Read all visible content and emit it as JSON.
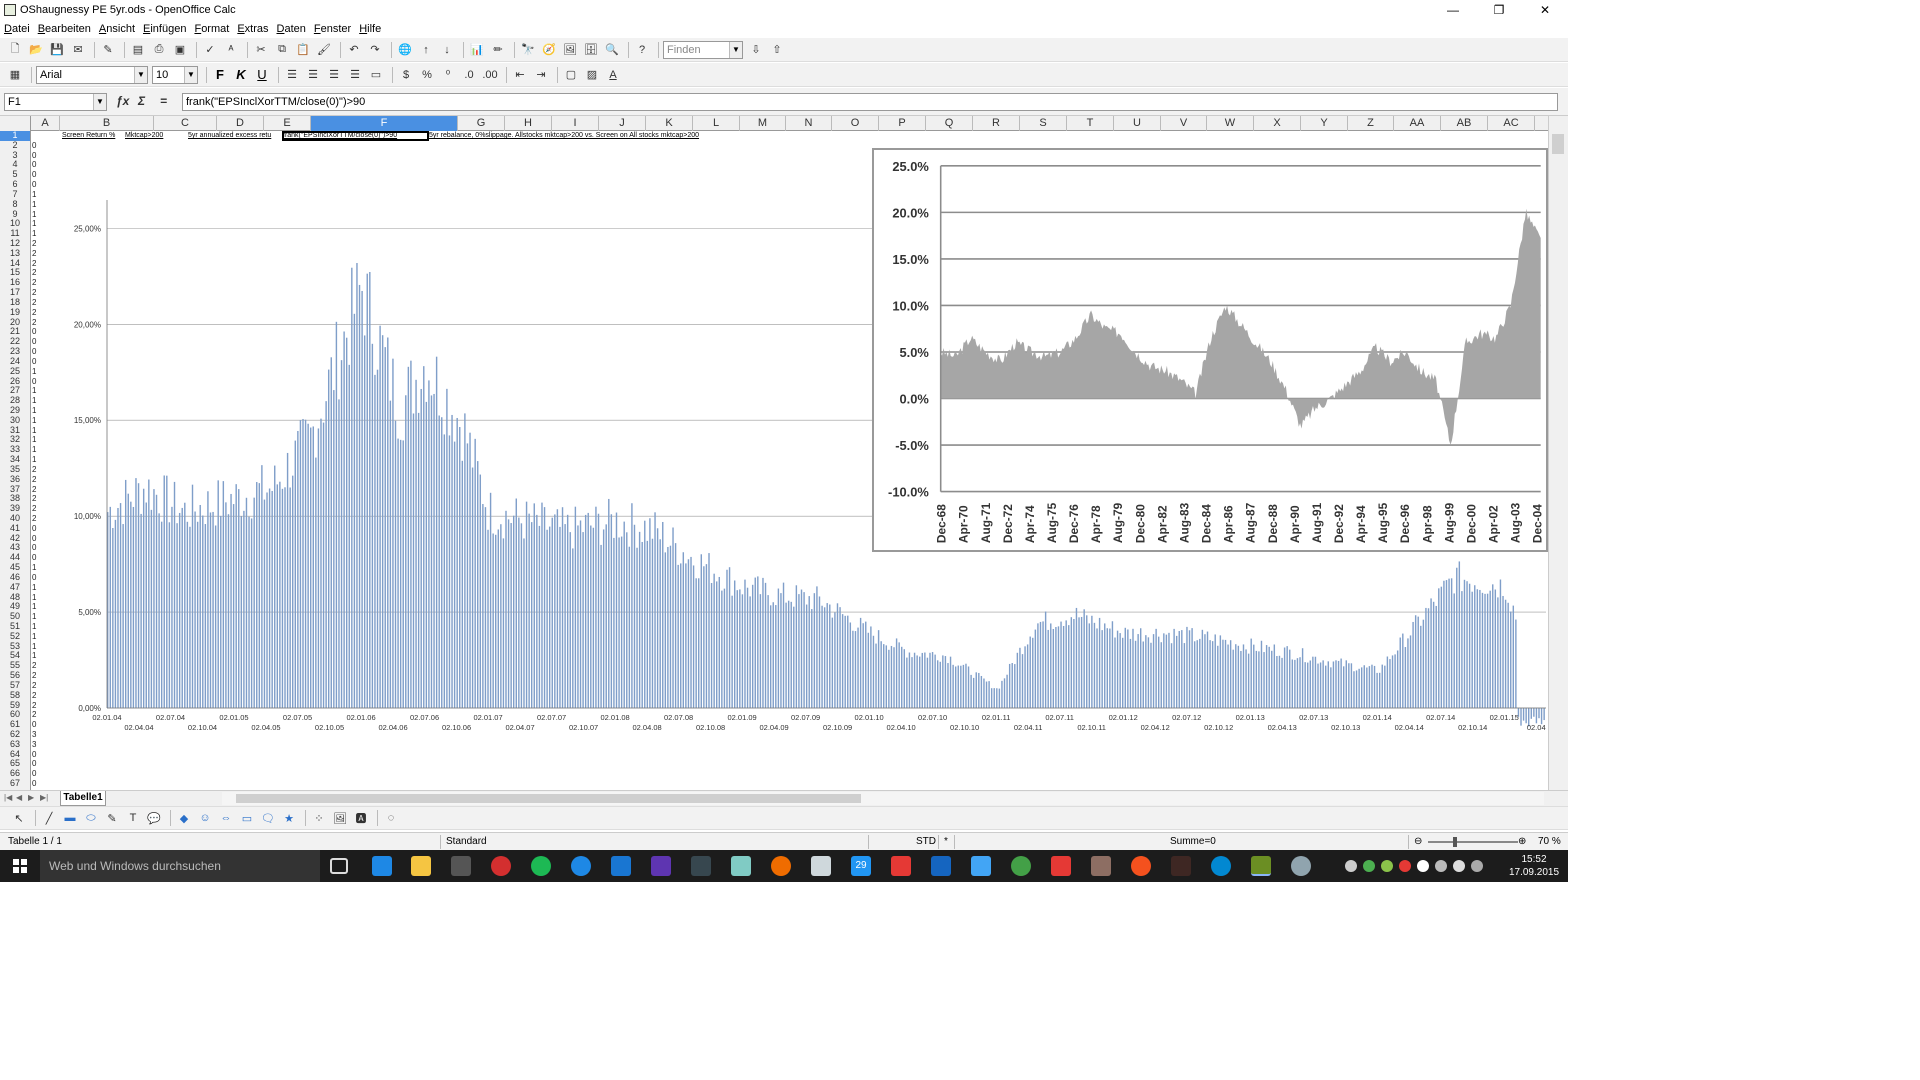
{
  "window": {
    "title": "OShaugnessy PE 5yr.ods - OpenOffice Calc",
    "controls": [
      "—",
      "❐",
      "✕"
    ]
  },
  "menu": [
    "Datei",
    "Bearbeiten",
    "Ansicht",
    "Einfügen",
    "Format",
    "Extras",
    "Daten",
    "Fenster",
    "Hilfe"
  ],
  "toolbar": {
    "find_placeholder": "Finden",
    "font_name": "Arial",
    "font_size": "10",
    "bold": "F",
    "italic": "K",
    "underline": "U"
  },
  "formula_bar": {
    "cell_ref": "F1",
    "formula": "frank(\"EPSInclXorTTM/close(0)\")>90"
  },
  "columns": [
    "A",
    "B",
    "C",
    "D",
    "E",
    "F",
    "G",
    "H",
    "I",
    "J",
    "K",
    "L",
    "M",
    "N",
    "O",
    "P",
    "Q",
    "R",
    "S",
    "T",
    "U",
    "V",
    "W",
    "X",
    "Y",
    "Z",
    "AA",
    "AB",
    "AC",
    "AD"
  ],
  "selected_column": "F",
  "rows": [
    "1",
    "2",
    "3",
    "4",
    "5",
    "6",
    "7",
    "8",
    "9",
    "10",
    "11",
    "12",
    "13",
    "14",
    "15",
    "16",
    "17",
    "18",
    "19",
    "20",
    "21",
    "22",
    "23",
    "24",
    "25",
    "26",
    "27",
    "28",
    "29",
    "30",
    "31",
    "32",
    "33",
    "34",
    "35",
    "36",
    "37",
    "38",
    "39",
    "40",
    "41",
    "42",
    "43",
    "44",
    "45",
    "46",
    "47",
    "48",
    "49",
    "50",
    "51",
    "52",
    "53",
    "54",
    "55",
    "56",
    "57",
    "58",
    "59",
    "60",
    "61",
    "62",
    "63",
    "64",
    "65",
    "66",
    "67"
  ],
  "col_a_values": [
    "",
    "0",
    "0",
    "0",
    "0",
    "0",
    "1",
    "1",
    "1",
    "1",
    "1",
    "2",
    "2",
    "2",
    "2",
    "2",
    "2",
    "2",
    "2",
    "2",
    "0",
    "0",
    "0",
    "0",
    "1",
    "0",
    "1",
    "1",
    "1",
    "1",
    "1",
    "1",
    "1",
    "1",
    "2",
    "2",
    "2",
    "2",
    "2",
    "2",
    "0",
    "0",
    "0",
    "0",
    "1",
    "0",
    "1",
    "1",
    "1",
    "1",
    "1",
    "1",
    "1",
    "1",
    "2",
    "2",
    "2",
    "2",
    "2",
    "2",
    "0",
    "3",
    "3",
    "0",
    "0",
    "0",
    "0"
  ],
  "row1_cells": {
    "b": "Screen Return %",
    "c": "Mktcap>200",
    "d": "5yr annualized excess retu",
    "f": "frank(\"EPSInclXorTTM/close(0)\")>90",
    "g": "5yr rebalance, 0%slippage. Allstocks mktcap>200 vs. Screen on All stocks mktcap>200"
  },
  "sheet_tab": "Tabelle1",
  "status": {
    "sheet": "Tabelle 1 / 1",
    "style": "Standard",
    "mode": "STD",
    "modified": "*",
    "sum": "Summe=0",
    "zoom": "70 %"
  },
  "taskbar": {
    "search_placeholder": "Web und Windows durchsuchen",
    "time": "15:52",
    "date": "17.09.2015",
    "calendar_badge": "29"
  },
  "chart_data": [
    {
      "type": "bar",
      "title": "",
      "ylim": [
        0,
        0.27
      ],
      "y_ticks": [
        "0,00%",
        "5,00%",
        "10,00%",
        "15,00%",
        "20,00%",
        "25,00%"
      ],
      "x_labels_upper": [
        "02.01.04",
        "02.07.04",
        "02.01.05",
        "02.07.05",
        "02.01.06",
        "02.07.06",
        "02.01.07",
        "02.07.07",
        "02.01.08",
        "02.07.08",
        "02.01.09",
        "02.07.09",
        "02.01.10",
        "02.07.10",
        "02.01.11",
        "02.07.11",
        "02.01.12",
        "02.07.12",
        "02.01.13",
        "02.07.13",
        "02.01.14",
        "02.07.14",
        "02.01.15"
      ],
      "x_labels_lower": [
        "02.04.04",
        "02.10.04",
        "02.04.05",
        "02.10.05",
        "02.04.06",
        "02.10.06",
        "02.04.07",
        "02.10.07",
        "02.04.08",
        "02.10.08",
        "02.04.09",
        "02.10.09",
        "02.04.10",
        "02.10.10",
        "02.04.11",
        "02.10.11",
        "02.04.12",
        "02.10.12",
        "02.04.13",
        "02.10.13",
        "02.04.14",
        "02.10.14",
        "02.04"
      ],
      "x": [
        0,
        0.3,
        0.6,
        1,
        1.3,
        1.6,
        2,
        2.3,
        2.5,
        2.8,
        3,
        3.3,
        3.6,
        4,
        4.3,
        4.6,
        5,
        5.3,
        5.6,
        6,
        6.3,
        6.6,
        7,
        7.3,
        7.6,
        8,
        8.3,
        8.6,
        9,
        9.3,
        9.6,
        10,
        10.3,
        10.6,
        11,
        11.3
      ],
      "values": [
        0.105,
        0.118,
        0.105,
        0.112,
        0.118,
        0.145,
        0.225,
        0.16,
        0.185,
        0.15,
        0.105,
        0.1,
        0.095,
        0.1,
        0.095,
        0.08,
        0.065,
        0.06,
        0.058,
        0.04,
        0.03,
        0.028,
        0.01,
        0.045,
        0.05,
        0.04,
        0.04,
        0.038,
        0.033,
        0.03,
        0.025,
        0.02,
        0.045,
        0.07,
        0.065,
        0.005
      ],
      "color": "#7f9ec9"
    },
    {
      "type": "area",
      "ylim": [
        -0.1,
        0.25
      ],
      "y_ticks": [
        "-10.0%",
        "-5.0%",
        "0.0%",
        "5.0%",
        "10.0%",
        "15.0%",
        "20.0%",
        "25.0%"
      ],
      "x_labels": [
        "Dec-68",
        "Apr-70",
        "Aug-71",
        "Dec-72",
        "Apr-74",
        "Aug-75",
        "Dec-76",
        "Apr-78",
        "Aug-79",
        "Dec-80",
        "Apr-82",
        "Aug-83",
        "Dec-84",
        "Apr-86",
        "Aug-87",
        "Dec-88",
        "Apr-90",
        "Aug-91",
        "Dec-92",
        "Apr-94",
        "Aug-95",
        "Dec-96",
        "Apr-98",
        "Aug-99",
        "Dec-00",
        "Apr-02",
        "Aug-03",
        "Dec-04"
      ],
      "values": [
        0.05,
        0.045,
        0.065,
        0.05,
        0.04,
        0.06,
        0.05,
        0.045,
        0.05,
        0.065,
        0.09,
        0.075,
        0.07,
        0.05,
        0.035,
        0.03,
        0.02,
        0.005,
        0.065,
        0.1,
        0.08,
        0.06,
        0.04,
        0.01,
        -0.03,
        -0.01,
        0.0,
        0.015,
        0.03,
        0.055,
        0.04,
        0.05,
        0.03,
        0.02,
        -0.05,
        0.06,
        0.07,
        0.065,
        0.1,
        0.2,
        0.17
      ],
      "color": "#a6a6a6"
    }
  ]
}
